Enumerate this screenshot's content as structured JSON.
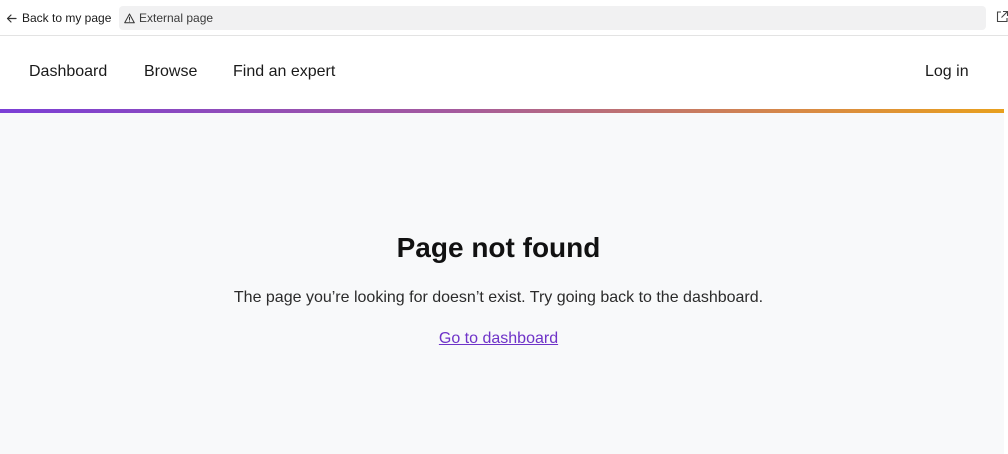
{
  "topbar": {
    "back_label": "Back to my page",
    "external_label": "External page",
    "icons": {
      "back": "arrow-left-icon",
      "warning": "warning-triangle-icon",
      "open": "open-external-icon"
    }
  },
  "nav": {
    "items": [
      {
        "label": "Dashboard"
      },
      {
        "label": "Browse"
      },
      {
        "label": "Find an expert"
      }
    ],
    "login_label": "Log in"
  },
  "main": {
    "title": "Page not found",
    "message": "The page you’re looking for doesn’t exist. Try going back to the dashboard.",
    "link_label": "Go to dashboard"
  },
  "colors": {
    "link": "#6f33c8",
    "gradient_start": "#7b3fd6",
    "gradient_end": "#e8a01e",
    "page_background": "#f8f9fa"
  }
}
